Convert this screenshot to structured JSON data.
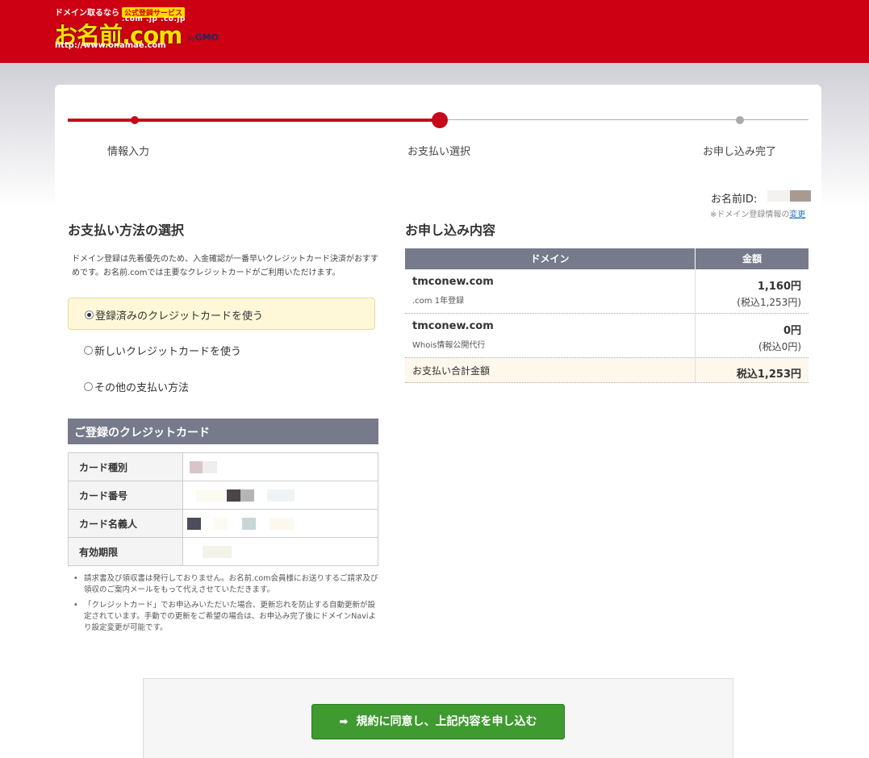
{
  "header": {
    "tagline": "ドメイン取るなら",
    "badge": "公式登録サービス",
    "tlds": ".com .jp .co.jp",
    "brand": "お名前.com",
    "by": "by",
    "gmo": "GMO",
    "url": "http://www.onamae.com"
  },
  "steps": [
    {
      "label": "情報入力",
      "state": "done"
    },
    {
      "label": "お支払い選択",
      "state": "current"
    },
    {
      "label": "お申し込み完了",
      "state": "todo"
    }
  ],
  "account": {
    "id_label": "お名前ID:",
    "change_note_prefix": "※ドメイン登録情報の",
    "change_link": "変更"
  },
  "payment": {
    "title": "お支払い方法の選択",
    "description": "ドメイン登録は先着優先のため、入金確認が一番早いクレジットカード決済がおすすめです。お名前.comでは主要なクレジットカードがご利用いただけます。",
    "options": [
      {
        "label": "登録済みのクレジットカードを使う",
        "selected": true
      },
      {
        "label": "新しいクレジットカードを使う",
        "selected": false
      },
      {
        "label": "その他の支払い方法",
        "selected": false
      }
    ]
  },
  "card": {
    "title": "ご登録のクレジットカード",
    "rows": [
      {
        "label": "カード種別"
      },
      {
        "label": "カード番号"
      },
      {
        "label": "カード名義人"
      },
      {
        "label": "有効期限"
      }
    ]
  },
  "notes": [
    "請求書及び領収書は発行しておりません。お名前.com会員様にお送りするご請求及び領収のご案内メールをもって代えさせていただきます。",
    "「クレジットカード」でお申込みいただいた場合、更新忘れを防止する自動更新が設定されています。手動での更新をご希望の場合は、お申込み完了後にドメインNaviより設定変更が可能です。"
  ],
  "order": {
    "title": "お申し込み内容",
    "col_domain": "ドメイン",
    "col_amount": "金額",
    "items": [
      {
        "domain": "tmconew.com",
        "detail": ".com 1年登録",
        "price": "1,160円",
        "price_tax": "(税込1,253円)"
      },
      {
        "domain": "tmconew.com",
        "detail": "Whois情報公開代行",
        "price": "0円",
        "price_tax": "(税込0円)"
      }
    ],
    "total_label": "お支払い合計金額",
    "total_value": "税込1,253円"
  },
  "submit": {
    "label": "規約に同意し、上記内容を申し込む"
  },
  "colors": {
    "brand_red": "#cc0012",
    "progress_red": "#c70a1a",
    "table_header": "#777a8a",
    "submit_green": "#3f9a2f"
  }
}
